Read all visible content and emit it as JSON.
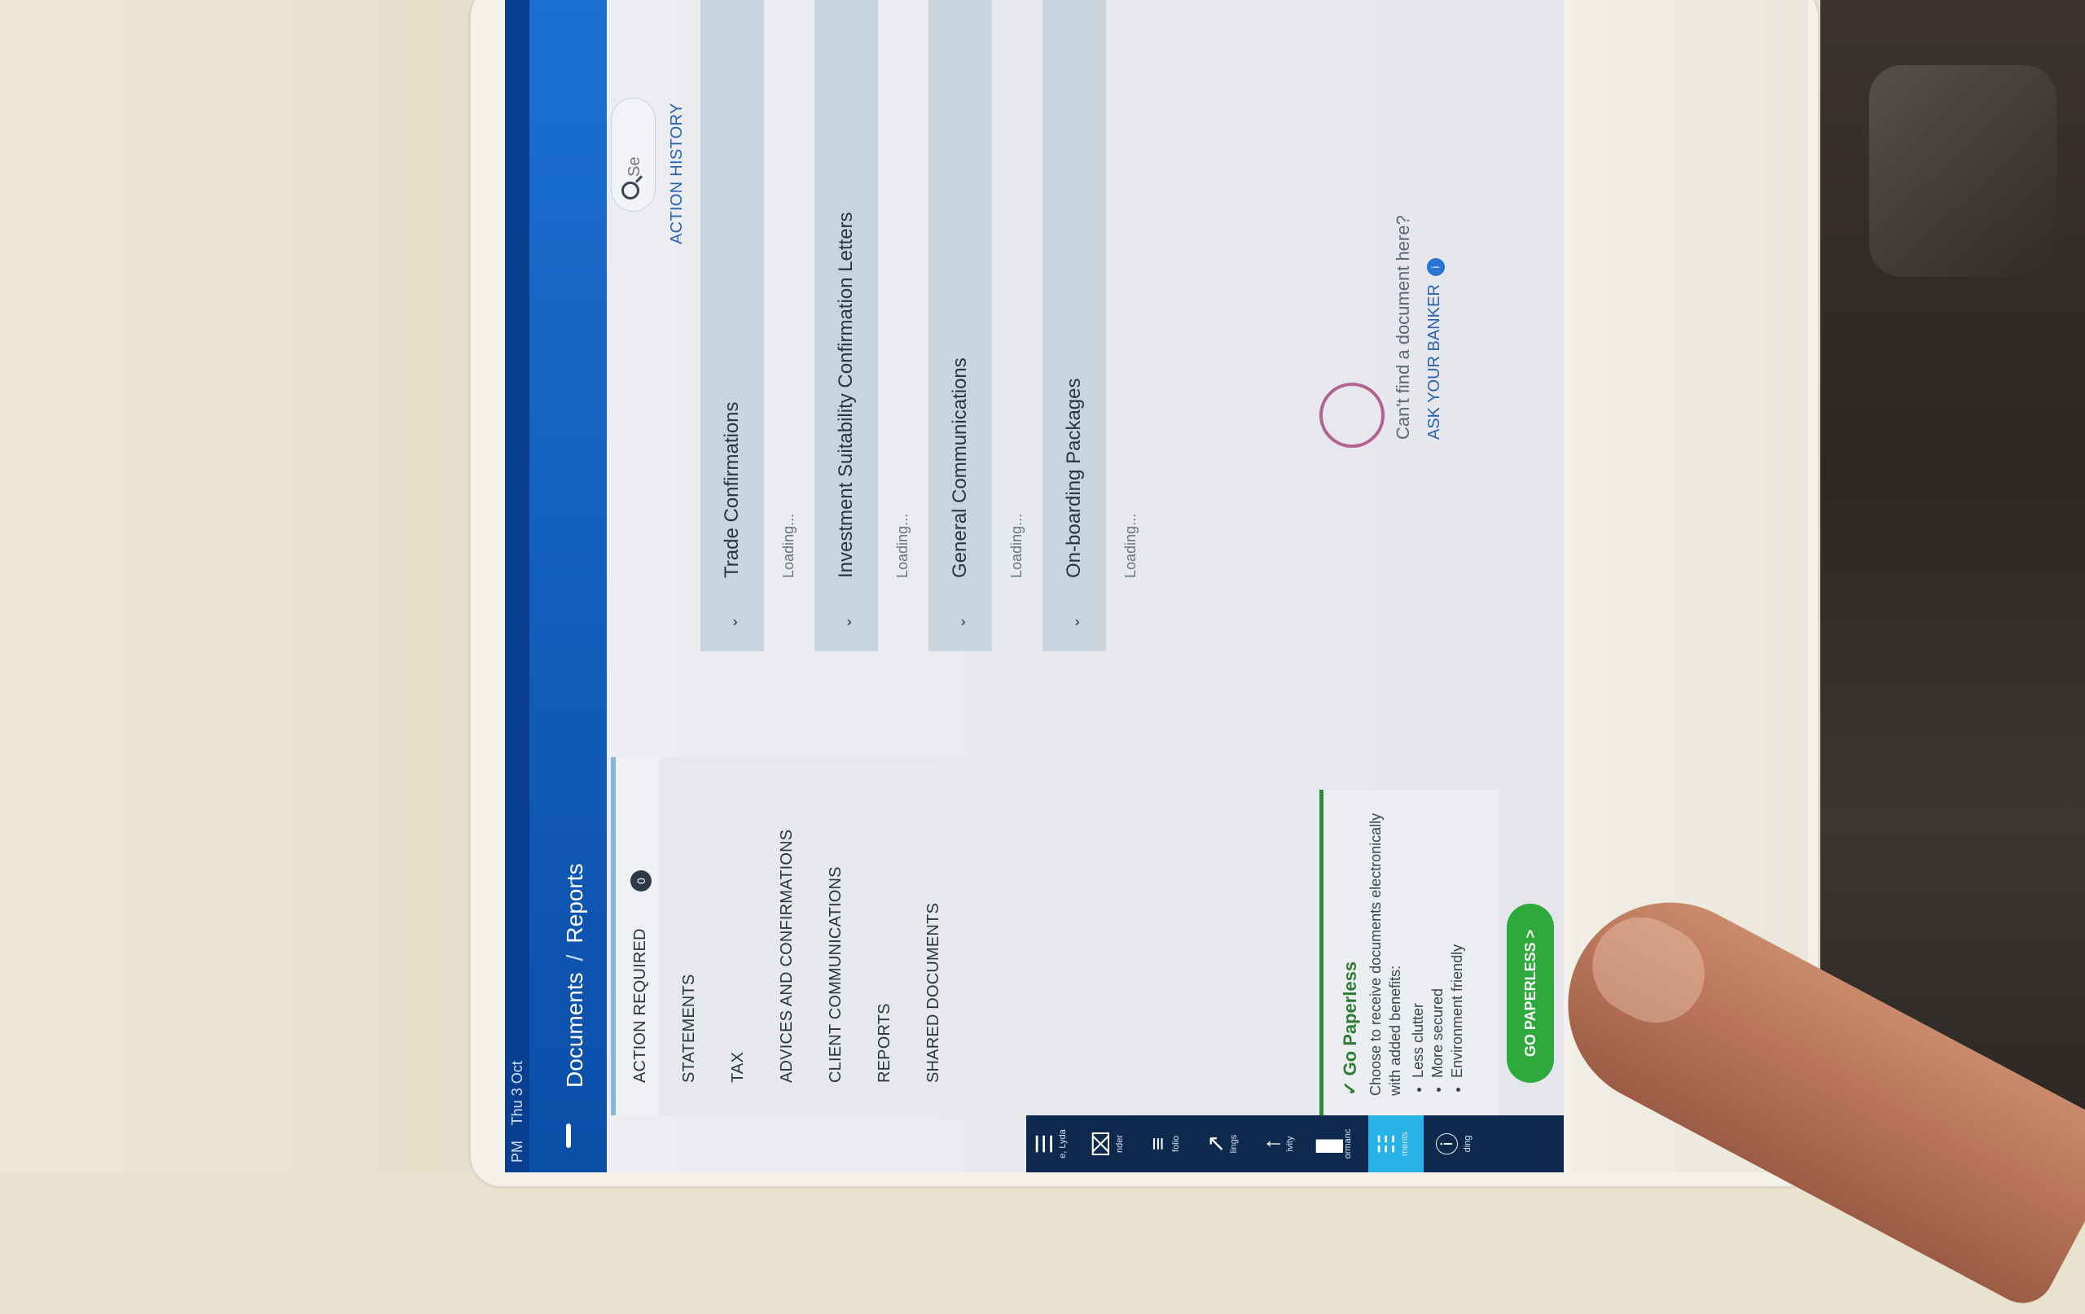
{
  "status": {
    "time": "PM",
    "date": "Thu 3 Oct"
  },
  "breadcrumb": {
    "parent": "Documents",
    "separator": "/",
    "current": "Reports"
  },
  "rail": {
    "items": [
      {
        "label": "e, Lyda",
        "glyph": "☰"
      },
      {
        "label": "nder",
        "glyph": "⌧"
      },
      {
        "label": "folio",
        "glyph": "≡"
      },
      {
        "label": "lings",
        "glyph": "↗"
      },
      {
        "label": "ivity",
        "glyph": "↑"
      },
      {
        "label": "ormanc",
        "glyph": "▊"
      },
      {
        "label": "ments",
        "glyph": "☷"
      },
      {
        "label": "ding",
        "glyph": "ⓘ"
      }
    ]
  },
  "tabs": [
    {
      "label": "ACTION REQUIRED",
      "badge": "0"
    },
    {
      "label": "STATEMENTS"
    },
    {
      "label": "TAX"
    },
    {
      "label": "ADVICES AND CONFIRMATIONS"
    },
    {
      "label": "CLIENT COMMUNICATIONS"
    },
    {
      "label": "REPORTS"
    },
    {
      "label": "SHARED DOCUMENTS"
    }
  ],
  "paperless": {
    "title": "Go Paperless",
    "body": "Choose to receive documents electronically with added benefits:",
    "benefits": [
      "Less clutter",
      "More secured",
      "Environment friendly"
    ],
    "button": "GO PAPERLESS >"
  },
  "main": {
    "action_history": "ACTION HISTORY",
    "search_placeholder": "Se",
    "sections": [
      {
        "title": "Trade Confirmations",
        "status": "Loading..."
      },
      {
        "title": "Investment Suitability Confirmation Letters",
        "status": "Loading..."
      },
      {
        "title": "General Communications",
        "status": "Loading..."
      },
      {
        "title": "On-boarding Packages",
        "status": "Loading..."
      }
    ],
    "help_text": "Can't find a document here?",
    "ask_banker": "ASK YOUR BANKER"
  },
  "colors": {
    "header": "#0b4ea8",
    "accent": "#27b3e6",
    "green": "#2ea93c",
    "link": "#2a62b5"
  }
}
